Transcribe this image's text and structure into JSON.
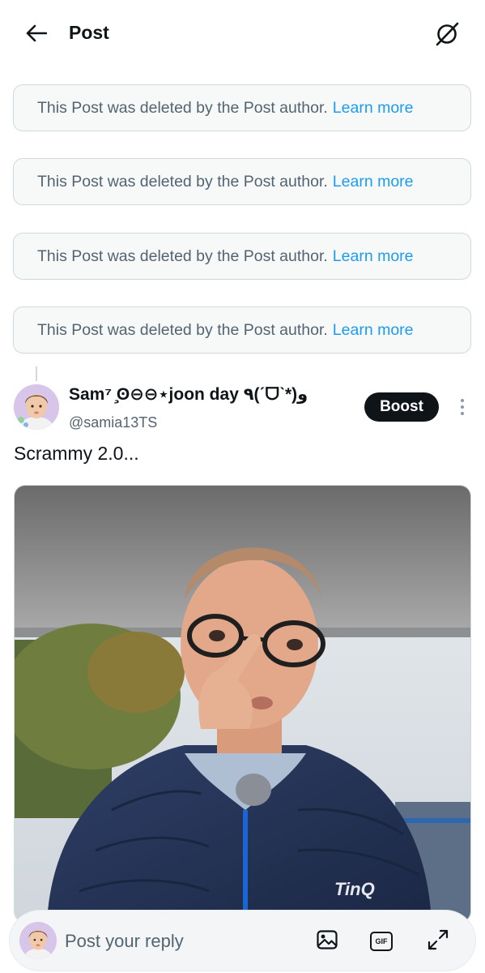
{
  "header": {
    "title": "Post",
    "back_icon": "arrow-left-icon",
    "action_icon": "slashed-circle-icon"
  },
  "deleted_posts": [
    {
      "message": "This Post was deleted by the Post author.",
      "link": "Learn more"
    },
    {
      "message": "This Post was deleted by the Post author.",
      "link": "Learn more"
    },
    {
      "message": "This Post was deleted by the Post author.",
      "link": "Learn more"
    },
    {
      "message": "This Post was deleted by the Post author.",
      "link": "Learn more"
    }
  ],
  "post": {
    "display_name": "Sam⁷ ̧ʘ⊖⊖⋆joon day ٩(ˊᗜˋ*)و",
    "handle": "@samia13TS",
    "boost_label": "Boost",
    "text": "Scrammy 2.0...",
    "media_jacket_text": "TinQ"
  },
  "reply_bar": {
    "placeholder": "Post your reply",
    "gif_label": "GIF"
  },
  "colors": {
    "accent": "#1d9bf0",
    "text_primary": "#0f1419",
    "text_secondary": "#536471",
    "border": "#cfd9de"
  }
}
